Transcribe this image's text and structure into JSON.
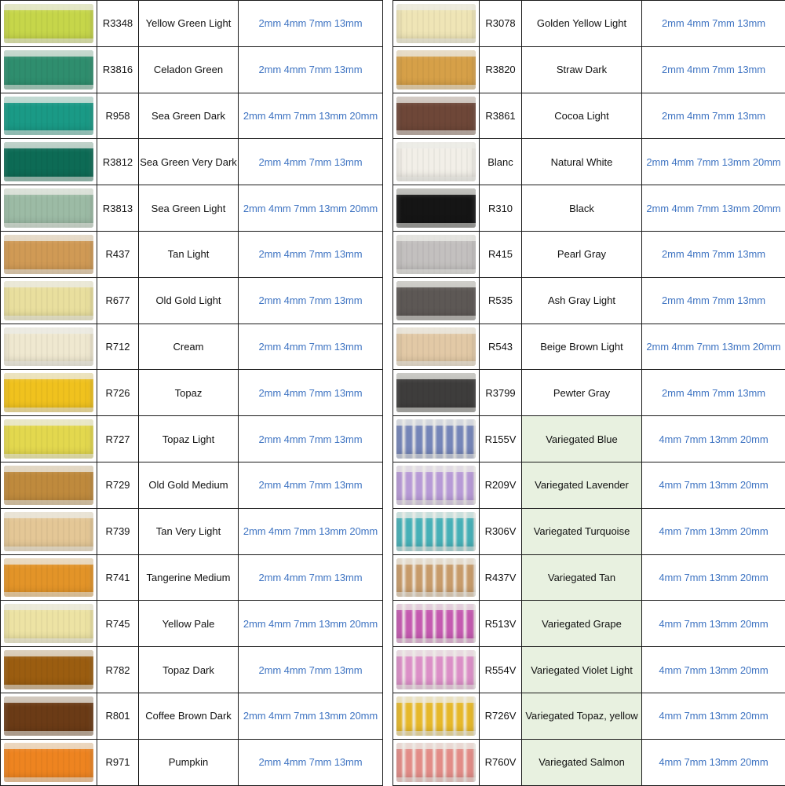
{
  "left_rows": [
    {
      "code": "R3348",
      "name": "Yellow Green Light",
      "sizes": "2mm 4mm 7mm 13mm",
      "color": "#c6d64a"
    },
    {
      "code": "R3816",
      "name": "Celadon Green",
      "sizes": "2mm 4mm 7mm 13mm",
      "color": "#2f8e6e"
    },
    {
      "code": "R958",
      "name": "Sea Green Dark",
      "sizes": "2mm 4mm 7mm 13mm 20mm",
      "color": "#1a9a86"
    },
    {
      "code": "R3812",
      "name": "Sea Green Very Dark",
      "sizes": "2mm 4mm 7mm 13mm",
      "color": "#0d6b55"
    },
    {
      "code": "R3813",
      "name": "Sea Green Light",
      "sizes": "2mm 4mm 7mm 13mm 20mm",
      "color": "#9cbba5"
    },
    {
      "code": "R437",
      "name": "Tan Light",
      "sizes": "2mm 4mm 7mm 13mm",
      "color": "#d09a55"
    },
    {
      "code": "R677",
      "name": "Old Gold Light",
      "sizes": "2mm 4mm 7mm 13mm",
      "color": "#e9df9e"
    },
    {
      "code": "R712",
      "name": "Cream",
      "sizes": "2mm 4mm 7mm 13mm",
      "color": "#efe8d0"
    },
    {
      "code": "R726",
      "name": "Topaz",
      "sizes": "2mm 4mm 7mm 13mm",
      "color": "#f0c21e"
    },
    {
      "code": "R727",
      "name": "Topaz Light",
      "sizes": "2mm 4mm 7mm 13mm",
      "color": "#e3d84e"
    },
    {
      "code": "R729",
      "name": "Old Gold Medium",
      "sizes": "2mm 4mm 7mm 13mm",
      "color": "#bf8a3d"
    },
    {
      "code": "R739",
      "name": "Tan Very Light",
      "sizes": "2mm 4mm 7mm 13mm 20mm",
      "color": "#e4c796"
    },
    {
      "code": "R741",
      "name": "Tangerine Medium",
      "sizes": "2mm 4mm 7mm 13mm",
      "color": "#e39428"
    },
    {
      "code": "R745",
      "name": "Yellow Pale",
      "sizes": "2mm 4mm 7mm 13mm 20mm",
      "color": "#ede3a4"
    },
    {
      "code": "R782",
      "name": "Topaz Dark",
      "sizes": "2mm 4mm 7mm 13mm",
      "color": "#9b5d10"
    },
    {
      "code": "R801",
      "name": "Coffee Brown Dark",
      "sizes": "2mm 4mm 7mm 13mm 20mm",
      "color": "#6b3b16"
    },
    {
      "code": "R971",
      "name": "Pumpkin",
      "sizes": "2mm 4mm 7mm 13mm",
      "color": "#ee8420"
    }
  ],
  "right_rows": [
    {
      "code": "R3078",
      "name": "Golden Yellow Light",
      "sizes": "2mm 4mm 7mm 13mm",
      "color": "#efe5b6",
      "variegated": false
    },
    {
      "code": "R3820",
      "name": "Straw Dark",
      "sizes": "2mm 4mm 7mm 13mm",
      "color": "#d6a048",
      "variegated": false
    },
    {
      "code": "R3861",
      "name": "Cocoa Light",
      "sizes": "2mm 4mm 7mm 13mm",
      "color": "#6e4738",
      "variegated": false
    },
    {
      "code": "Blanc",
      "name": "Natural White",
      "sizes": "2mm 4mm 7mm 13mm 20mm",
      "color": "#f2efe8",
      "variegated": false
    },
    {
      "code": "R310",
      "name": "Black",
      "sizes": "2mm 4mm 7mm 13mm 20mm",
      "color": "#151515",
      "variegated": false
    },
    {
      "code": "R415",
      "name": "Pearl Gray",
      "sizes": "2mm 4mm 7mm 13mm",
      "color": "#c3c0bf",
      "variegated": false
    },
    {
      "code": "R535",
      "name": "Ash Gray Light",
      "sizes": "2mm 4mm 7mm 13mm",
      "color": "#5d5855",
      "variegated": false
    },
    {
      "code": "R543",
      "name": "Beige Brown Light",
      "sizes": "2mm 4mm 7mm 13mm 20mm",
      "color": "#e2c9a6",
      "variegated": false
    },
    {
      "code": "R3799",
      "name": "Pewter Gray",
      "sizes": "2mm 4mm 7mm 13mm",
      "color": "#3e3d3c",
      "variegated": false
    },
    {
      "code": "R155V",
      "name": "Variegated Blue",
      "sizes": "4mm 7mm 13mm 20mm",
      "color": "#7585b8",
      "variegated": true
    },
    {
      "code": "R209V",
      "name": "Variegated Lavender",
      "sizes": "4mm 7mm 13mm 20mm",
      "color": "#b79ad6",
      "variegated": true
    },
    {
      "code": "R306V",
      "name": "Variegated Turquoise",
      "sizes": "4mm 7mm 13mm 20mm",
      "color": "#46b0b7",
      "variegated": true
    },
    {
      "code": "R437V",
      "name": "Variegated Tan",
      "sizes": "4mm 7mm 13mm 20mm",
      "color": "#c79b6a",
      "variegated": true
    },
    {
      "code": "R513V",
      "name": "Variegated Grape",
      "sizes": "4mm 7mm 13mm 20mm",
      "color": "#c45ab0",
      "variegated": true
    },
    {
      "code": "R554V",
      "name": "Variegated Violet Light",
      "sizes": "4mm 7mm 13mm 20mm",
      "color": "#db8fc7",
      "variegated": true
    },
    {
      "code": "R726V",
      "name": "Variegated Topaz, yellow",
      "sizes": "4mm 7mm 13mm 20mm",
      "color": "#e6b82a",
      "variegated": true
    },
    {
      "code": "R760V",
      "name": "Variegated Salmon",
      "sizes": "4mm 7mm 13mm 20mm",
      "color": "#e28c87",
      "variegated": true
    }
  ],
  "colors": {
    "size_text": "#3f74c2",
    "variegated_bg": "#e8f1e0",
    "border": "#1a1a1a"
  }
}
